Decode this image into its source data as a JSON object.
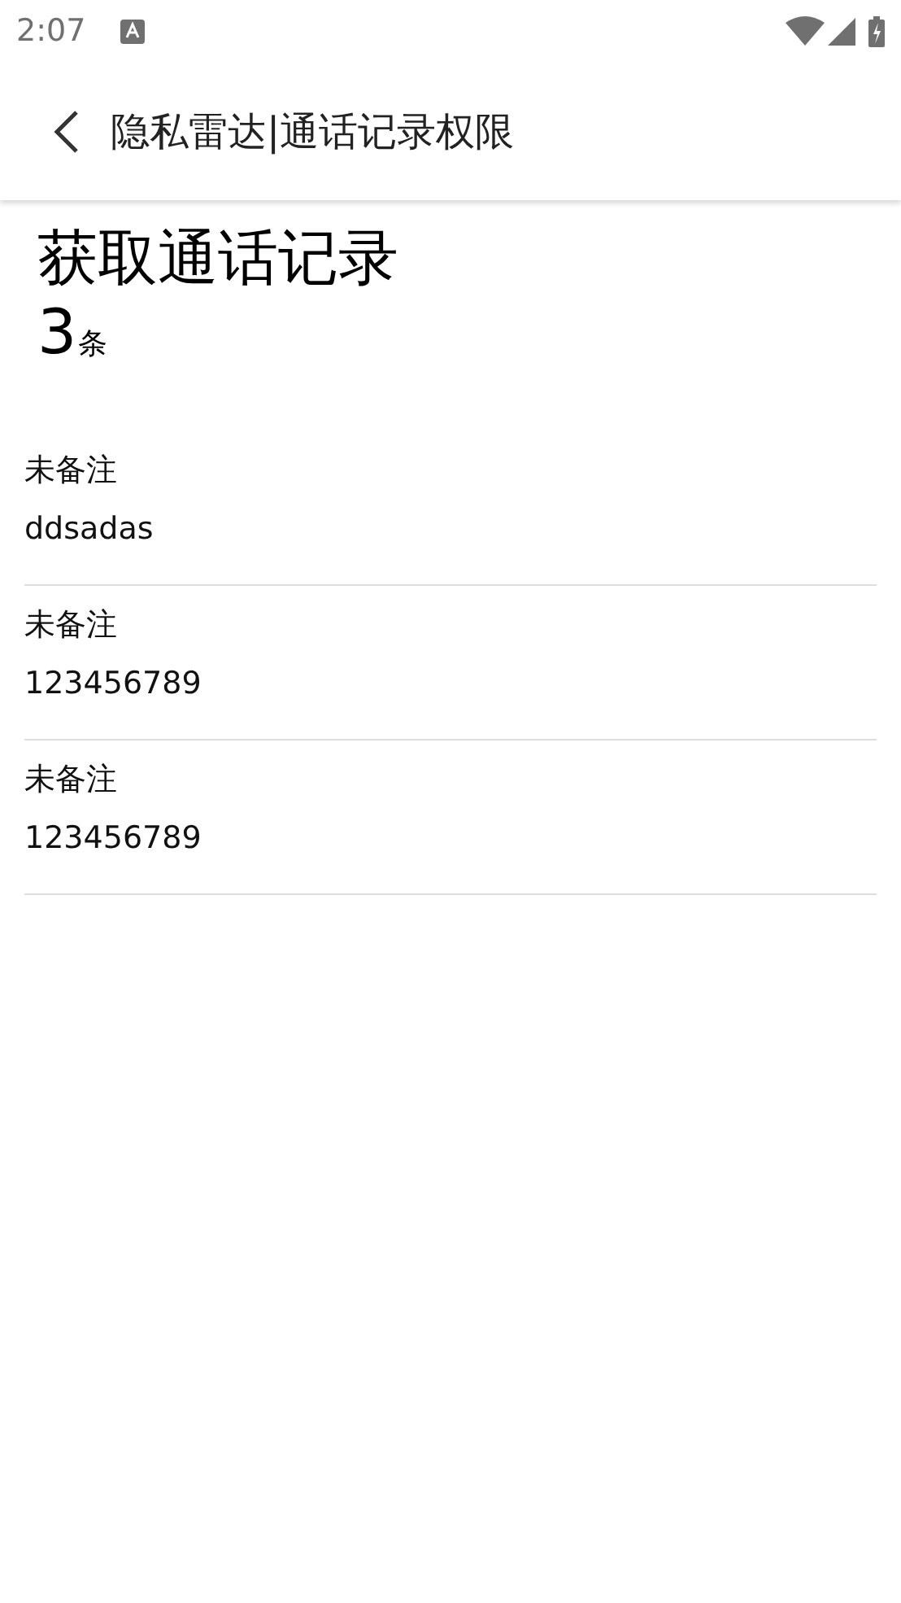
{
  "status_bar": {
    "time": "2:07"
  },
  "app_bar": {
    "title": "隐私雷达|通话记录权限"
  },
  "header": {
    "title": "获取通话记录",
    "count": "3",
    "unit": "条"
  },
  "records": [
    {
      "name": "未备注",
      "number": "ddsadas"
    },
    {
      "name": "未备注",
      "number": "123456789"
    },
    {
      "name": "未备注",
      "number": "123456789"
    }
  ]
}
